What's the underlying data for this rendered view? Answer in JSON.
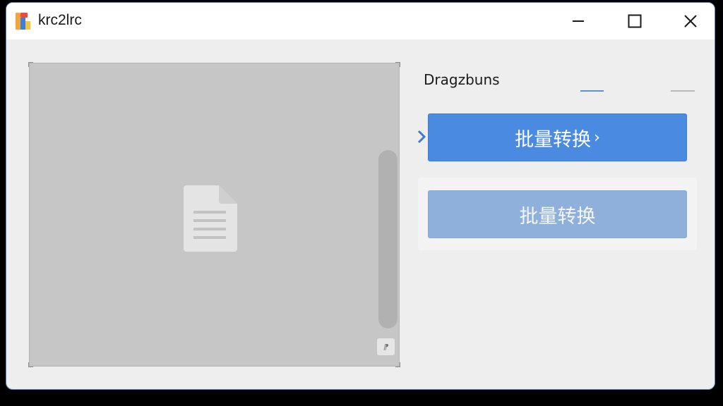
{
  "window": {
    "title": "krc2lrc"
  },
  "drop_area": {
    "icon": "document-icon",
    "grip_glyph": "⁋"
  },
  "panel": {
    "label": "Dragzbuns",
    "primary_button": {
      "label": "批量转换",
      "chevron": "›"
    },
    "secondary_button": {
      "label": "批量转换"
    }
  },
  "colors": {
    "accent": "#4a8ae0",
    "disabled": "#8fb0db",
    "drop_zone": "#c6c6c6"
  }
}
